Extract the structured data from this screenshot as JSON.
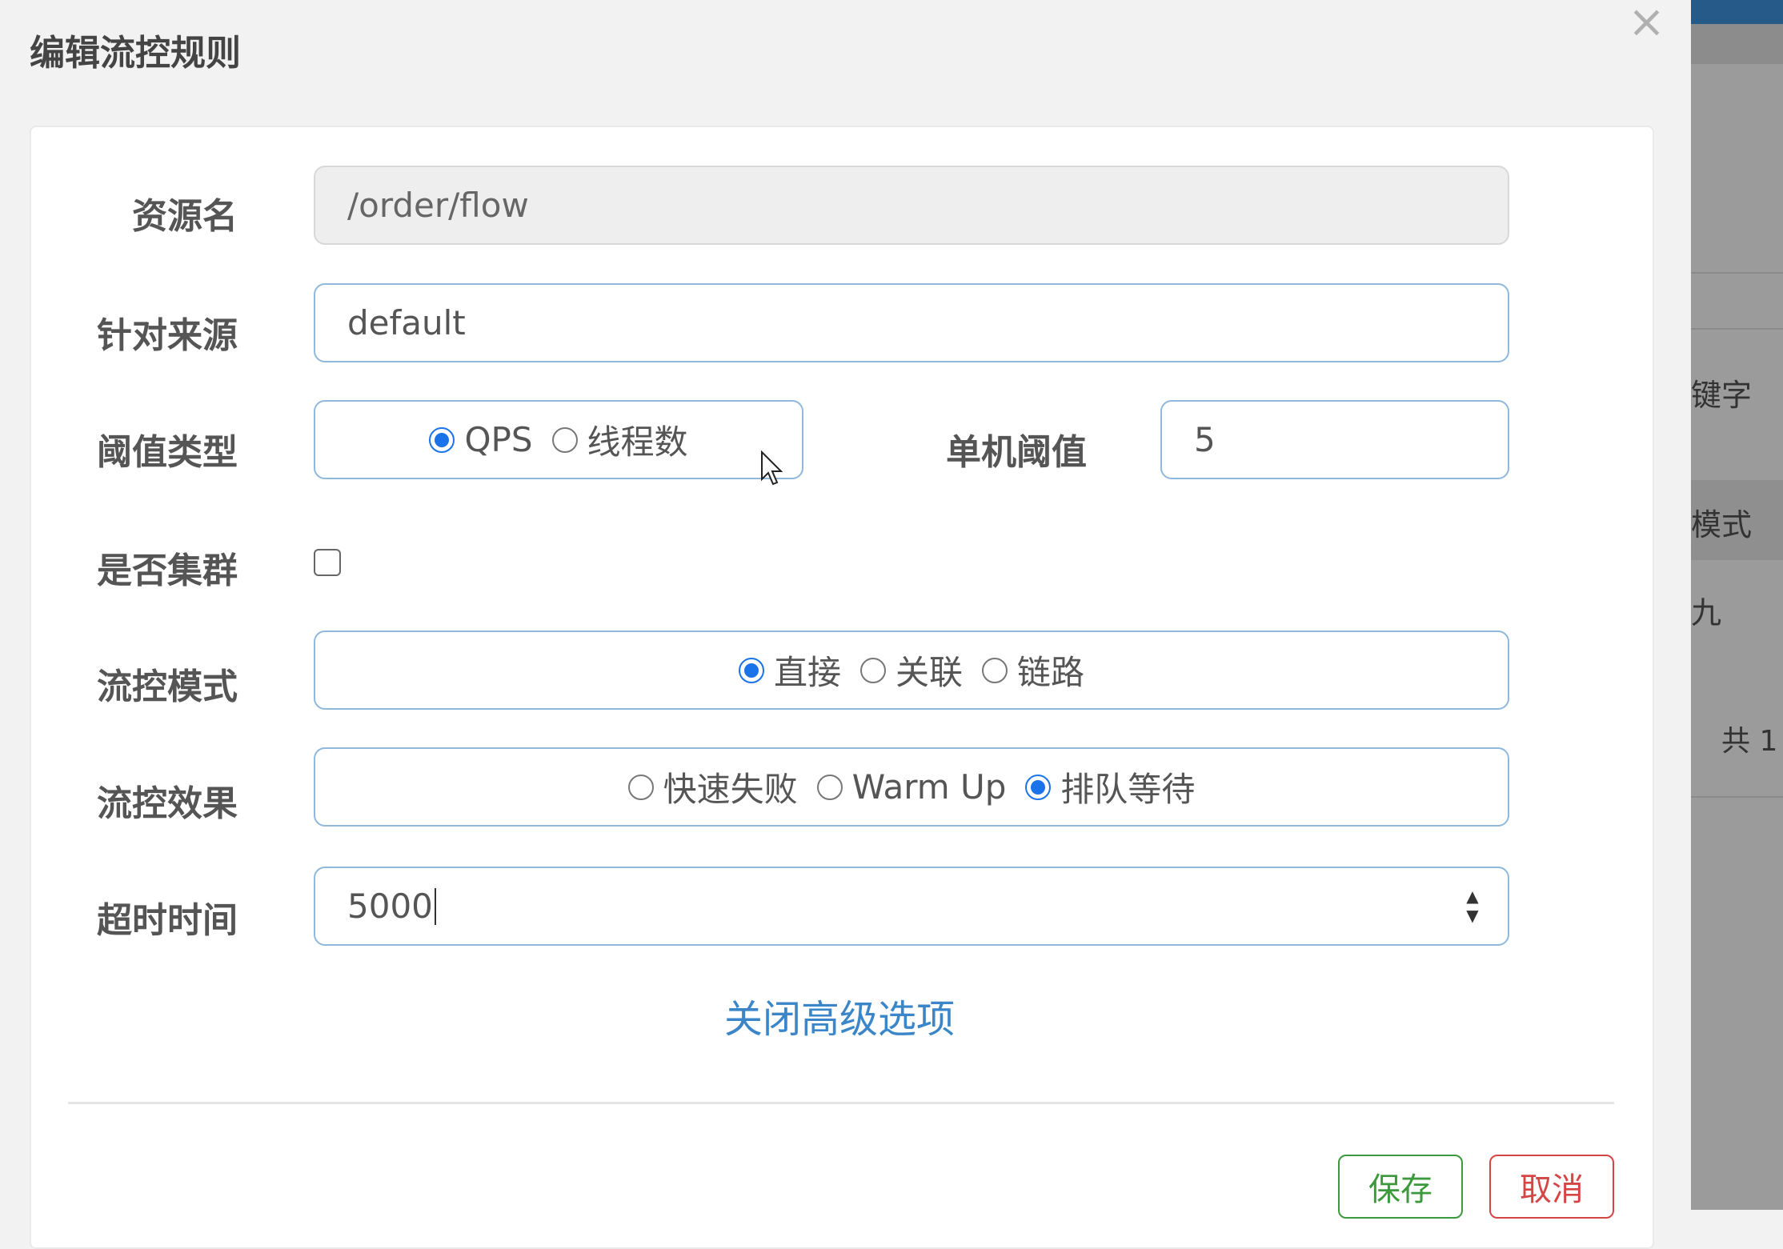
{
  "dialog": {
    "title": "编辑流控规则",
    "close_icon": "close-icon"
  },
  "form": {
    "resource": {
      "label": "资源名",
      "value": "/order/flow"
    },
    "origin": {
      "label": "针对来源",
      "value": "default"
    },
    "threshold_type": {
      "label": "阈值类型",
      "options": [
        "QPS",
        "线程数"
      ],
      "selected": "QPS"
    },
    "single_threshold": {
      "label": "单机阈值",
      "value": "5"
    },
    "cluster": {
      "label": "是否集群",
      "checked": false
    },
    "flow_mode": {
      "label": "流控模式",
      "options": [
        "直接",
        "关联",
        "链路"
      ],
      "selected": "直接"
    },
    "flow_effect": {
      "label": "流控效果",
      "options": [
        "快速失败",
        "Warm Up",
        "排队等待"
      ],
      "selected": "排队等待"
    },
    "timeout": {
      "label": "超时时间",
      "value": "5000"
    },
    "toggle_advanced": "关闭高级选项"
  },
  "buttons": {
    "save": "保存",
    "cancel": "取消"
  },
  "background": {
    "frag1": "键字",
    "frag2": "模式",
    "frag3": "九",
    "frag4": "共 1"
  },
  "colors": {
    "primary": "#1a73e8",
    "link": "#3a86c8",
    "save": "#3c9a3c",
    "cancel": "#d64545"
  }
}
